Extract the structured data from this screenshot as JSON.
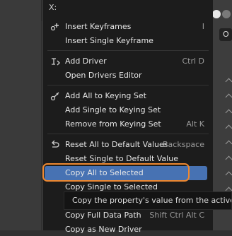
{
  "menu": {
    "title": "X:",
    "groups": [
      {
        "items": [
          {
            "label": "Insert Keyframes",
            "shortcut": "I",
            "icon": "keyframe-insert-icon"
          },
          {
            "label": "Insert Single Keyframe",
            "shortcut": ""
          }
        ]
      },
      {
        "items": [
          {
            "label": "Add Driver",
            "shortcut": "Ctrl D",
            "icon": "driver-icon"
          },
          {
            "label": "Open Drivers Editor",
            "shortcut": ""
          }
        ]
      },
      {
        "items": [
          {
            "label": "Add All to Keying Set",
            "shortcut": "",
            "icon": "keying-set-icon"
          },
          {
            "label": "Add Single to Keying Set",
            "shortcut": ""
          },
          {
            "label": "Remove from Keying Set",
            "shortcut": "Alt K"
          }
        ]
      },
      {
        "items": [
          {
            "label": "Reset All to Default Values",
            "shortcut": "Backspace",
            "icon": "reset-icon"
          },
          {
            "label": "Reset Single to Default Value",
            "shortcut": ""
          },
          {
            "label": "Copy All to Selected",
            "shortcut": "",
            "highlighted": true
          },
          {
            "label": "Copy Single to Selected",
            "shortcut": ""
          },
          {
            "label": "Copy Full Data Path",
            "shortcut": "Shift Ctrl Alt C"
          },
          {
            "label": "Copy as New Driver",
            "shortcut": ""
          }
        ]
      }
    ]
  },
  "tooltip": {
    "text": "Copy the property's value from the active ite"
  },
  "right_panel": {
    "field_text": "O"
  },
  "colors": {
    "highlight": "#4772b3",
    "annotation_ring": "#ee8830",
    "menu_bg": "#1c1c1c"
  }
}
